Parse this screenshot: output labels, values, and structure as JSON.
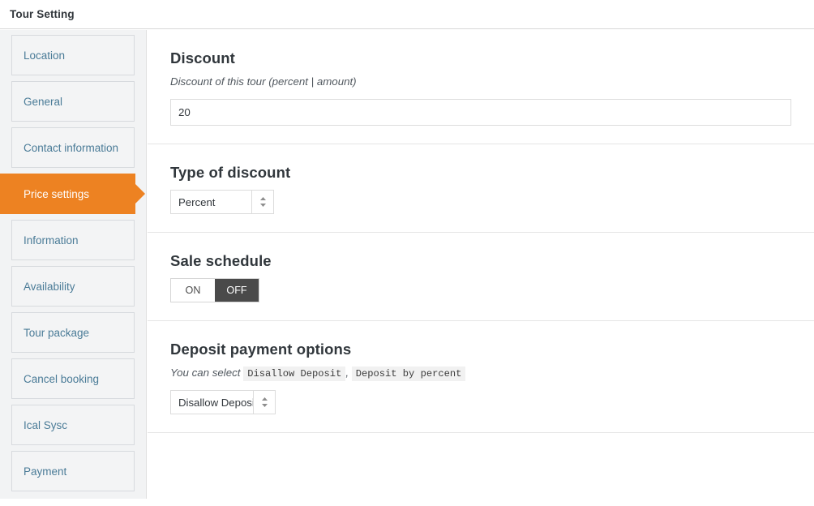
{
  "header": {
    "title": "Tour Setting"
  },
  "sidebar": {
    "items": [
      {
        "label": "Location",
        "active": false
      },
      {
        "label": "General",
        "active": false
      },
      {
        "label": "Contact information",
        "active": false
      },
      {
        "label": "Price settings",
        "active": true
      },
      {
        "label": "Information",
        "active": false
      },
      {
        "label": "Availability",
        "active": false
      },
      {
        "label": "Tour package",
        "active": false
      },
      {
        "label": "Cancel booking",
        "active": false
      },
      {
        "label": "Ical Sysc",
        "active": false
      },
      {
        "label": "Payment",
        "active": false
      }
    ]
  },
  "main": {
    "discount": {
      "title": "Discount",
      "description": "Discount of this tour (percent | amount)",
      "value": "20",
      "placeholder": ""
    },
    "type_of_discount": {
      "title": "Type of discount",
      "selected": "Percent",
      "options": [
        "Percent"
      ]
    },
    "sale_schedule": {
      "title": "Sale schedule",
      "on_label": "ON",
      "off_label": "OFF",
      "selected": "OFF"
    },
    "deposit_payment": {
      "title": "Deposit payment options",
      "desc_prefix": "You can select",
      "code_one": "Disallow Deposit",
      "desc_separator": ",",
      "code_two": "Deposit by percent",
      "selected": "Disallow Deposit",
      "options": [
        "Disallow Deposit",
        "Deposit by percent"
      ]
    }
  },
  "colors": {
    "accent": "#ed8222",
    "sidebar_bg": "#f2f3f4",
    "nav_text": "#4a7b97",
    "heading": "#31373c",
    "toggle_active": "#4a4a4a"
  }
}
